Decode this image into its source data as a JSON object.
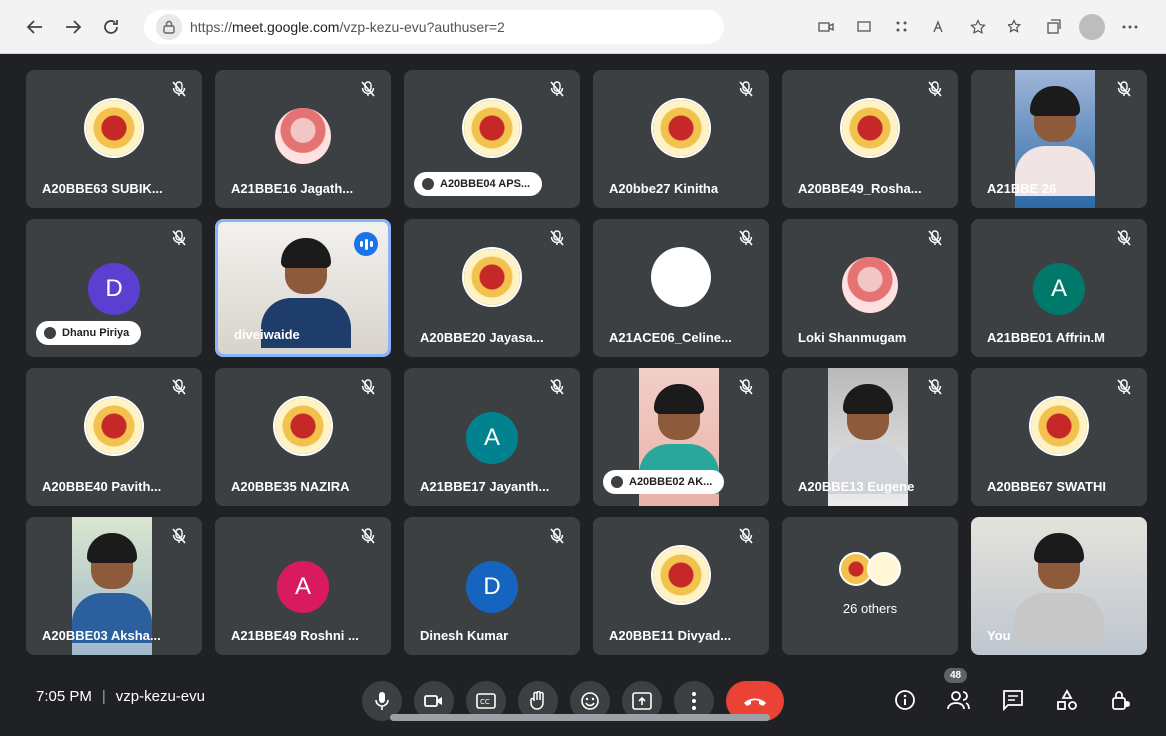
{
  "browser": {
    "url_scheme": "https://",
    "url_host": "meet.google.com",
    "url_path": "/vzp-kezu-evu?authuser=2",
    "back_icon": "arrow-left-icon",
    "forward_icon": "arrow-right-icon",
    "reload_icon": "refresh-icon"
  },
  "tiles": [
    {
      "name": "A20BBE63 SUBIK...",
      "kind": "emblem",
      "muted": true
    },
    {
      "name": "A21BBE16 Jagath...",
      "kind": "photo",
      "muted": true
    },
    {
      "name": "A20BBE04 APS...",
      "kind": "emblem",
      "muted": true,
      "hand_raised": true
    },
    {
      "name": "A20bbe27 Kinitha",
      "kind": "emblem",
      "muted": true
    },
    {
      "name": "A20BBE49_Rosha...",
      "kind": "emblem",
      "muted": true
    },
    {
      "name": "A21BBE 26",
      "kind": "video",
      "muted": true
    },
    {
      "name": "Dhanu Piriya",
      "kind": "letter",
      "letter": "D",
      "color": "#5b3fd1",
      "muted": true,
      "hand_raised": true
    },
    {
      "name": "diveiwaide",
      "kind": "video",
      "speaking": true,
      "active": true
    },
    {
      "name": "A20BBE20 Jayasa...",
      "kind": "emblem",
      "muted": true
    },
    {
      "name": "A21ACE06_Celine...",
      "kind": "logo",
      "muted": true
    },
    {
      "name": "Loki Shanmugam",
      "kind": "photo",
      "muted": true
    },
    {
      "name": "A21BBE01 Affrin.M",
      "kind": "letter",
      "letter": "A",
      "color": "#00796b",
      "muted": true
    },
    {
      "name": "A20BBE40 Pavith...",
      "kind": "emblem",
      "muted": true
    },
    {
      "name": "A20BBE35 NAZIRA",
      "kind": "emblem",
      "muted": true
    },
    {
      "name": "A21BBE17 Jayanth...",
      "kind": "letter",
      "letter": "A",
      "color": "#00838f",
      "muted": true
    },
    {
      "name": "A20BBE02 AK...",
      "kind": "video",
      "muted": true,
      "hand_raised": true
    },
    {
      "name": "A20BBE13 Eugene",
      "kind": "video",
      "muted": true
    },
    {
      "name": "A20BBE67 SWATHI",
      "kind": "emblem",
      "muted": true
    },
    {
      "name": "A20BBE03 Aksha...",
      "kind": "video",
      "muted": true
    },
    {
      "name": "A21BBE49 Roshni ...",
      "kind": "letter",
      "letter": "A",
      "color": "#d81b60",
      "muted": true
    },
    {
      "name": "Dinesh Kumar",
      "kind": "letter",
      "letter": "D",
      "color": "#1565c0",
      "muted": true
    },
    {
      "name": "A20BBE11 Divyad...",
      "kind": "emblem",
      "muted": true
    },
    {
      "name": "26 others",
      "kind": "others"
    },
    {
      "name": "You",
      "kind": "video"
    }
  ],
  "meeting": {
    "time": "7:05 PM",
    "separator": "|",
    "code": "vzp-kezu-evu",
    "participants_count": "48"
  },
  "colors": {
    "background": "#202124",
    "tile": "#3c4043",
    "active_border": "#8ab4f8",
    "end_call": "#ea4335"
  }
}
